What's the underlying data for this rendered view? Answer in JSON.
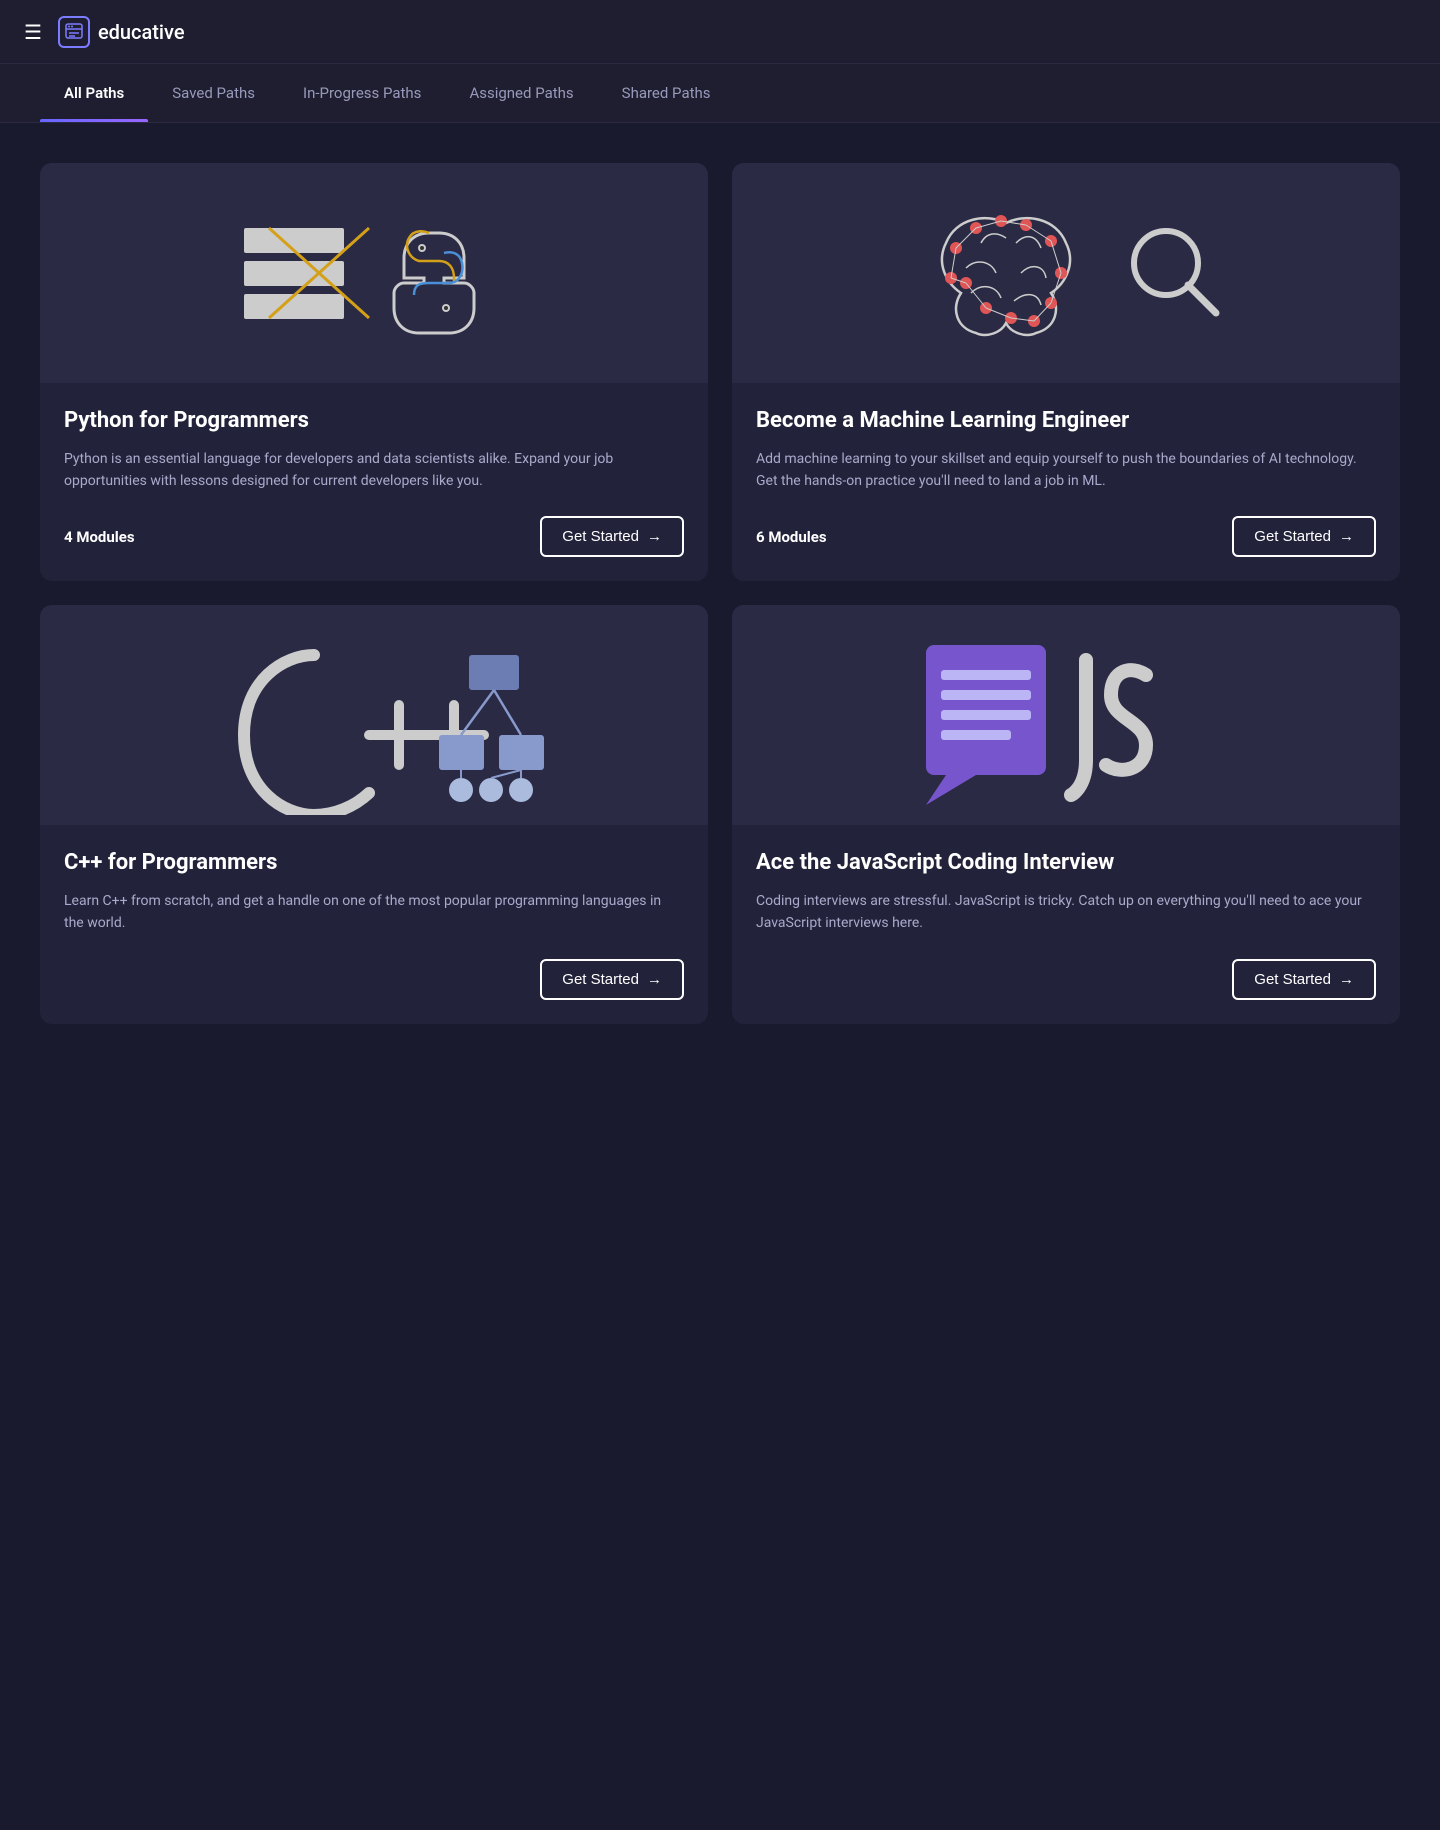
{
  "header": {
    "logo_text": "educative",
    "hamburger_icon": "☰"
  },
  "tabs": [
    {
      "id": "all-paths",
      "label": "All Paths",
      "active": true
    },
    {
      "id": "saved-paths",
      "label": "Saved Paths",
      "active": false
    },
    {
      "id": "in-progress-paths",
      "label": "In-Progress Paths",
      "active": false
    },
    {
      "id": "assigned-paths",
      "label": "Assigned Paths",
      "active": false
    },
    {
      "id": "shared-paths",
      "label": "Shared Paths",
      "active": false
    }
  ],
  "cards": [
    {
      "id": "python-programmers",
      "title": "Python for Programmers",
      "description": "Python is an essential language for developers and data scientists alike. Expand your job opportunities with lessons designed for current developers like you.",
      "modules": "4 Modules",
      "button_label": "Get Started",
      "button_arrow": "→"
    },
    {
      "id": "machine-learning",
      "title": "Become a Machine Learning Engineer",
      "description": "Add machine learning to your skillset and equip yourself to push the boundaries of AI technology. Get the hands-on practice you'll need to land a job in ML.",
      "modules": "6 Modules",
      "button_label": "Get Started",
      "button_arrow": "→"
    },
    {
      "id": "cpp-programmers",
      "title": "C++ for Programmers",
      "description": "Learn C++ from scratch, and get a handle on one of the most popular programming languages in the world.",
      "modules": "",
      "button_label": "Get Started",
      "button_arrow": "→"
    },
    {
      "id": "javascript-interview",
      "title": "Ace the JavaScript Coding Interview",
      "description": "Coding interviews are stressful. JavaScript is tricky. Catch up on everything you'll need to ace your JavaScript interviews here.",
      "modules": "",
      "button_label": "Get Started",
      "button_arrow": "→"
    }
  ]
}
